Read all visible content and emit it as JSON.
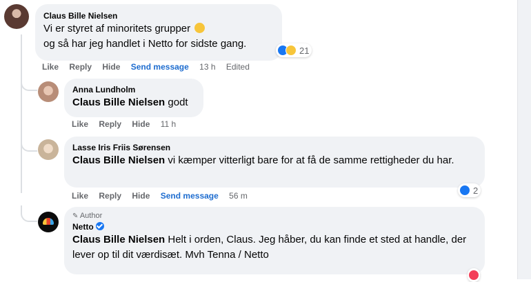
{
  "comment1": {
    "author": "Claus Bille Nielsen",
    "line1": "Vi er styret af minoritets grupper",
    "line2": "og så har jeg handlet i Netto for sidste gang.",
    "reaction_count": "21",
    "actions": {
      "like": "Like",
      "reply": "Reply",
      "hide": "Hide",
      "send": "Send message",
      "time": "13 h",
      "edited": "Edited"
    }
  },
  "reply1": {
    "author": "Anna Lundholm",
    "tag": "Claus Bille Nielsen",
    "text": " godt",
    "actions": {
      "like": "Like",
      "reply": "Reply",
      "hide": "Hide",
      "time": "11 h"
    }
  },
  "reply2": {
    "author": "Lasse Iris Friis Sørensen",
    "tag": "Claus Bille Nielsen",
    "text": " vi kæmper vitterligt bare for at få de samme rettigheder du har.",
    "reaction_count": "2",
    "actions": {
      "like": "Like",
      "reply": "Reply",
      "hide": "Hide",
      "send": "Send message",
      "time": "56 m"
    }
  },
  "reply3": {
    "badge": "Author",
    "author": "Netto",
    "tag": "Claus Bille Nielsen",
    "text": " Helt i orden, Claus. Jeg håber, du kan finde et sted at handle, der lever op til dit værdisæt. Mvh Tenna / Netto"
  },
  "colors": {
    "accent": "#1877f2",
    "bubble": "#f0f2f5",
    "meta": "#65676b",
    "love": "#f33e58"
  }
}
